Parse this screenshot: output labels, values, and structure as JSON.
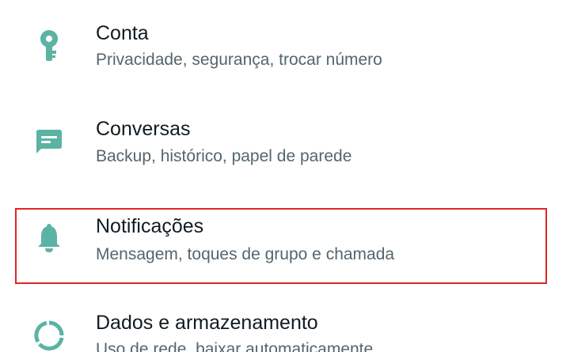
{
  "settings": {
    "accent_color": "#5bb3a4",
    "items": [
      {
        "title": "Conta",
        "subtitle": "Privacidade, segurança, trocar número",
        "icon": "key-icon"
      },
      {
        "title": "Conversas",
        "subtitle": "Backup, histórico, papel de parede",
        "icon": "chat-icon"
      },
      {
        "title": "Notificações",
        "subtitle": "Mensagem, toques de grupo e chamada",
        "icon": "bell-icon",
        "highlighted": true,
        "highlight_color": "#e02424"
      },
      {
        "title": "Dados e armazenamento",
        "subtitle": "Uso de rede, baixar automaticamente",
        "icon": "data-usage-icon"
      }
    ]
  }
}
